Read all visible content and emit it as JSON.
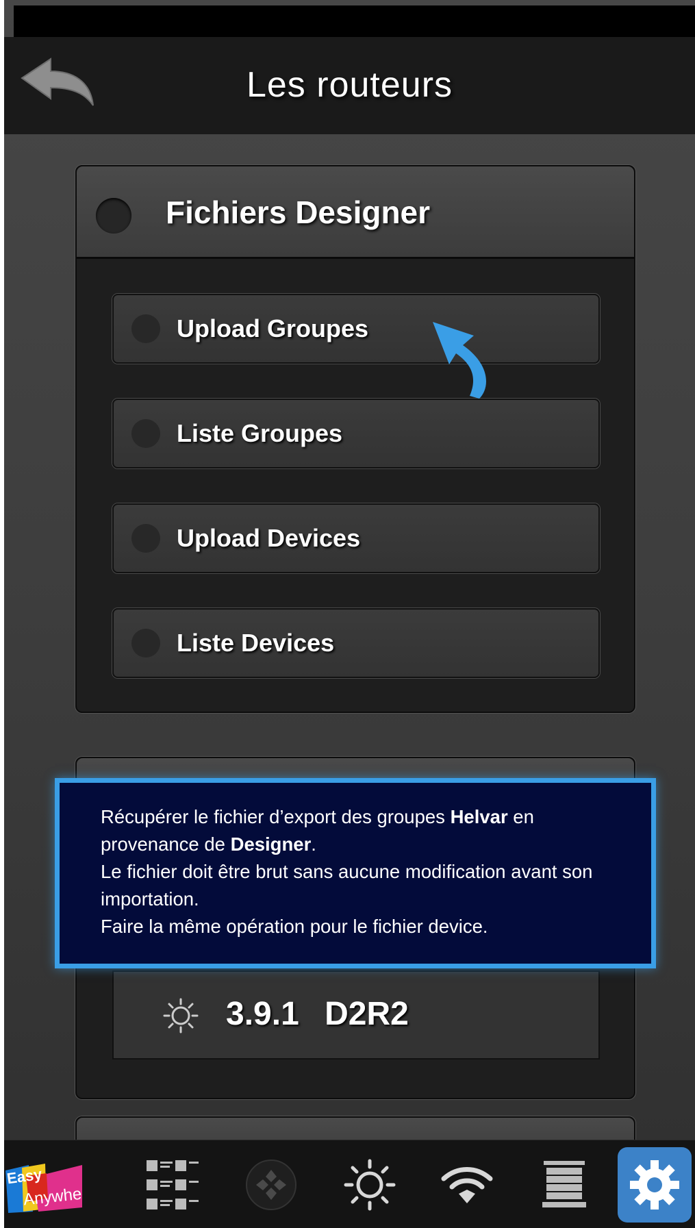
{
  "header": {
    "title": "Les routeurs"
  },
  "icons": {
    "back": "back-arrow-icon",
    "pointer": "curved-arrow-icon",
    "brightness": "sun-icon",
    "settings": "gear-icon"
  },
  "colors": {
    "accent_blue": "#3a9ee6",
    "tooltip_bg": "#030b3a",
    "active_tab": "#3c82c8"
  },
  "designer_panel": {
    "title": "Fichiers Designer",
    "items": [
      {
        "label": "Upload Groupes"
      },
      {
        "label": "Liste Groupes"
      },
      {
        "label": "Upload Devices"
      },
      {
        "label": "Liste Devices"
      }
    ]
  },
  "router_panel": {
    "version": "3.9.1",
    "model": "D2R2"
  },
  "tooltip": {
    "line1_pre": "Récupérer le fichier d’export des groupes ",
    "line1_bold": "Helvar",
    "line1_post": " en provenance de ",
    "line1_bold2": "Designer",
    "line1_end": ".",
    "line2": "Le fichier doit être brut sans aucune modification avant son importation.",
    "line3": "Faire la même opération pour le fichier device."
  },
  "tabbar": {
    "logo_line1": "Easy",
    "logo_line2": "Anywhere",
    "tabs": [
      "logo",
      "grid-list-icon",
      "dpad-icon",
      "sun-icon",
      "wifi-icon",
      "blind-icon",
      "gear-icon"
    ]
  }
}
